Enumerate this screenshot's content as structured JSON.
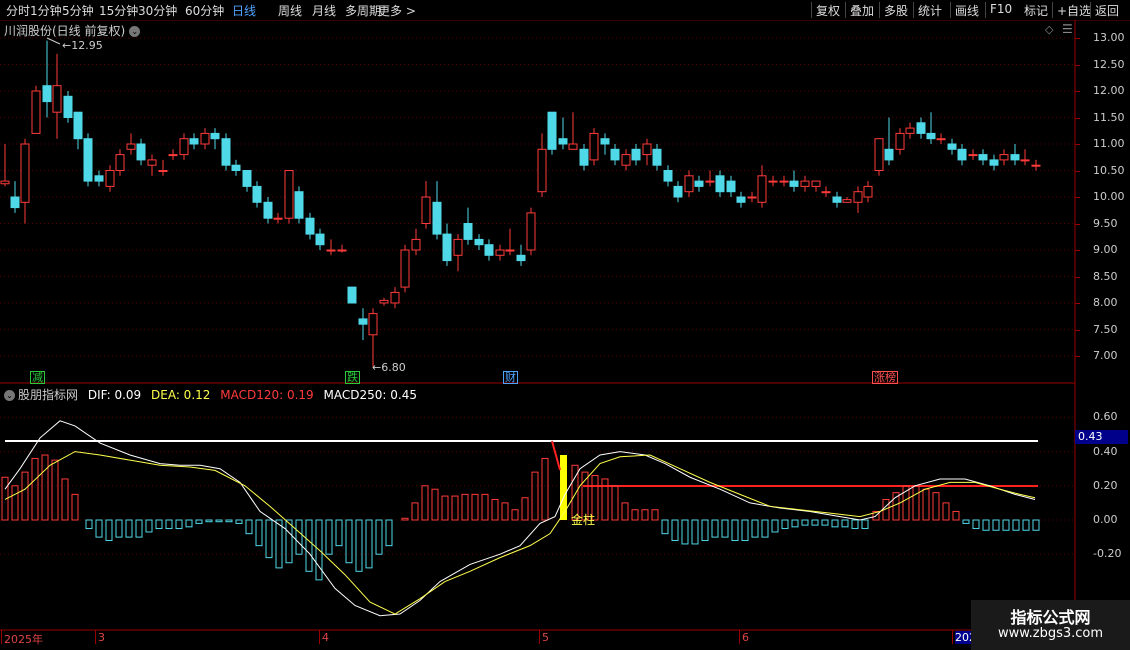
{
  "toolbar": {
    "left": [
      "分时",
      "1分钟",
      "5分钟",
      "15分钟",
      "30分钟",
      "60分钟",
      "日线",
      "周线",
      "月线",
      "多周期",
      "更多 >"
    ],
    "active_index": 6,
    "right": [
      "复权",
      "叠加",
      "多股",
      "统计",
      "画线",
      "F10",
      "+自选",
      "返回"
    ],
    "extra_right": "标记"
  },
  "main_title": "川润股份(日线 前复权)",
  "price_axis": [
    "13.00",
    "12.50",
    "12.00",
    "11.50",
    "11.00",
    "10.50",
    "10.00",
    "9.50",
    "9.00",
    "8.50",
    "8.00",
    "7.50",
    "7.00"
  ],
  "high_label": "12.95",
  "low_label": "6.80",
  "events": [
    {
      "text": "减",
      "color": "#29c93a"
    },
    {
      "text": "跌",
      "color": "#29c93a"
    },
    {
      "text": "财",
      "color": "#4fa3ff"
    },
    {
      "text": "涨榜",
      "color": "#ff5050"
    }
  ],
  "indicator": {
    "name": "股朋指标网",
    "dif": "DIF: 0.09",
    "dea": "DEA: 0.12",
    "macd120": "MACD120: 0.19",
    "macd250": "MACD250: 0.45",
    "axis": [
      "0.60",
      "0.40",
      "0.20",
      "0.00",
      "-0.20"
    ],
    "current_value": "0.43",
    "golden_label": "金柱"
  },
  "dates": [
    "2025年",
    "3",
    "4",
    "5",
    "6",
    "202"
  ],
  "watermark": {
    "line1": "指标公式网",
    "line2": "www.zbgs3.com"
  },
  "colors": {
    "up": "#ff3b3b",
    "down": "#4fd8e8",
    "grid": "#5a0000",
    "bg": "#000000"
  }
}
